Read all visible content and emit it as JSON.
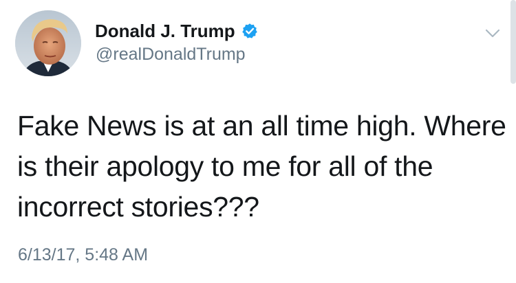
{
  "author": {
    "display_name": "Donald J. Trump",
    "handle": "@realDonaldTrump",
    "verified": true
  },
  "tweet": {
    "lines": [
      "Fake News is at an all time high. Where",
      "is their apology to me for all of the",
      "incorrect stories???"
    ],
    "timestamp": "6/13/17, 5:48 AM"
  },
  "icons": {
    "verified": "verified-badge-icon",
    "menu": "chevron-down-icon",
    "avatar": "profile-photo"
  },
  "colors": {
    "text_primary": "#14171a",
    "text_secondary": "#657786",
    "verified_blue": "#1da1f2",
    "chevron": "#aab8c2"
  }
}
